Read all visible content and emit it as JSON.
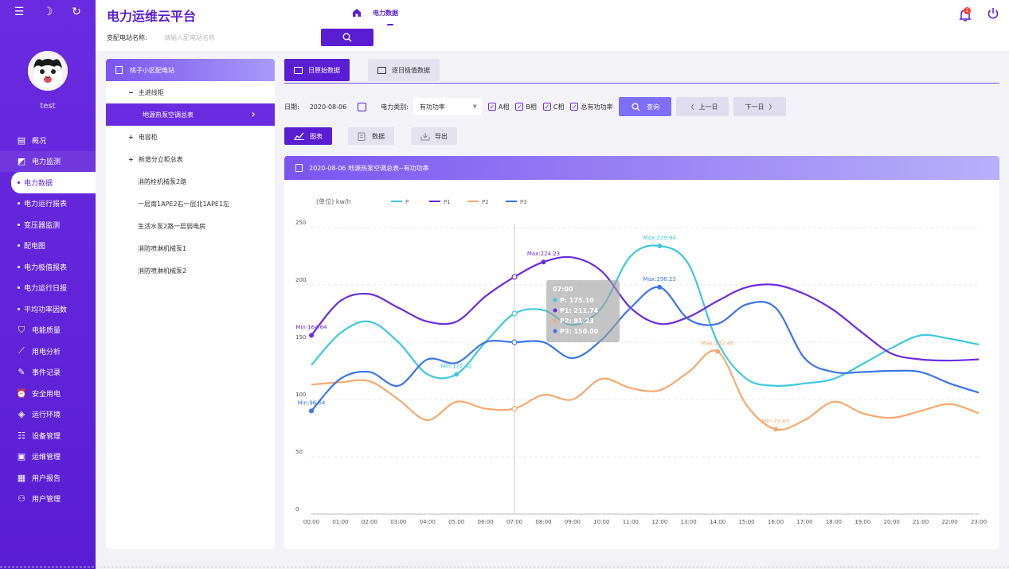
{
  "sidebar": {
    "top_icons": [
      "menu-icon",
      "moon-icon",
      "refresh-icon"
    ],
    "username": "test",
    "menu": [
      {
        "label": "概况",
        "icon": "dashboard-icon",
        "type": "main"
      },
      {
        "label": "电力监测",
        "icon": "monitor-icon",
        "type": "main"
      },
      {
        "label": "电力数据",
        "type": "sub",
        "active": true
      },
      {
        "label": "电力运行报表",
        "type": "sub"
      },
      {
        "label": "变压器监测",
        "type": "sub"
      },
      {
        "label": "配电图",
        "type": "sub"
      },
      {
        "label": "电力极值报表",
        "type": "sub"
      },
      {
        "label": "电力运行日报",
        "type": "sub"
      },
      {
        "label": "平均功率因数",
        "type": "sub"
      },
      {
        "label": "电能质量",
        "icon": "shield-icon",
        "type": "main"
      },
      {
        "label": "用电分析",
        "icon": "trend-icon",
        "type": "main"
      },
      {
        "label": "事件记录",
        "icon": "edit-doc-icon",
        "type": "main"
      },
      {
        "label": "安全用电",
        "icon": "alarm-icon",
        "type": "main"
      },
      {
        "label": "运行环境",
        "icon": "diamond-icon",
        "type": "main"
      },
      {
        "label": "设备管理",
        "icon": "list-icon",
        "type": "main"
      },
      {
        "label": "运维管理",
        "icon": "screen-icon",
        "type": "main"
      },
      {
        "label": "用户报告",
        "icon": "report-icon",
        "type": "main"
      },
      {
        "label": "用户管理",
        "icon": "users-icon",
        "type": "main"
      }
    ]
  },
  "header": {
    "title": "电力运维云平台",
    "nav_label": "电力数据",
    "search_label": "变配电站名称:",
    "search_placeholder": "请输入配电站名称",
    "notification_count": "2"
  },
  "tree": {
    "title": "桃子小区配电站",
    "items": [
      {
        "label": "主进线柜",
        "prefix": "−",
        "level": 1
      },
      {
        "label": "地源热泵空调总表",
        "level": 2,
        "active": true
      },
      {
        "label": "电容柜",
        "prefix": "+",
        "level": 1
      },
      {
        "label": "新增分立柜总表",
        "prefix": "+",
        "level": 1
      },
      {
        "label": "消防栓机械泵2路",
        "level": 2
      },
      {
        "label": "一层南1APE2右一层北1APE1左",
        "level": 2
      },
      {
        "label": "生活水泵2路一层弱电房",
        "level": 2
      },
      {
        "label": "消防喷淋机械泵1",
        "level": 2
      },
      {
        "label": "消防喷淋机械泵2",
        "level": 2
      }
    ]
  },
  "tabs": {
    "daily_raw": "日原始数据",
    "daily_extreme": "逐日极值数据"
  },
  "filter": {
    "date_label": "日期:",
    "date_value": "2020-08-06",
    "type_label": "电力类别:",
    "type_value": "有功功率",
    "phase_a": "A相",
    "phase_b": "B相",
    "phase_c": "C相",
    "total": "总有功功率",
    "query": "查询",
    "prev": "上一日",
    "next": "下一日"
  },
  "view_buttons": {
    "chart": "图表",
    "data": "数据",
    "export": "导出"
  },
  "chart_header": "2020-08-06  地源热泵空调总表--有功功率",
  "tooltip": {
    "time": "07:00",
    "lines": [
      "P:  175.10",
      "P1:  211.74",
      "P2:  91.23",
      "P3:  150.00"
    ]
  },
  "chart_data": {
    "type": "line",
    "unit_label": "(单位) kw/h",
    "x": [
      "00:00",
      "01:00",
      "02:00",
      "03:00",
      "04:00",
      "05:00",
      "06:00",
      "07:00",
      "08:00",
      "09:00",
      "10:00",
      "11:00",
      "12:00",
      "13:00",
      "14:00",
      "15:00",
      "16:00",
      "17:00",
      "18:00",
      "19:00",
      "20:00",
      "21:00",
      "22:00",
      "23:00"
    ],
    "ylim": [
      0,
      250
    ],
    "yticks": [
      0,
      50,
      100,
      150,
      200,
      250
    ],
    "grid": true,
    "legend_position": "top-left",
    "series": [
      {
        "name": "P",
        "color": "#3ec8dc",
        "values": [
          130,
          158,
          168,
          150,
          122,
          122,
          150,
          175,
          178,
          165,
          180,
          225,
          234,
          218,
          150,
          118,
          112,
          114,
          118,
          131,
          145,
          156,
          153,
          148
        ]
      },
      {
        "name": "P1",
        "color": "#6a2be0",
        "values": [
          156,
          186,
          192,
          180,
          168,
          168,
          190,
          207,
          220,
          224,
          212,
          180,
          166,
          172,
          186,
          198,
          200,
          192,
          178,
          158,
          140,
          135,
          134,
          135
        ]
      },
      {
        "name": "P2",
        "color": "#f5a96e",
        "values": [
          113,
          115,
          116,
          100,
          82,
          98,
          92,
          92,
          104,
          100,
          118,
          110,
          108,
          124,
          142,
          95,
          74,
          82,
          98,
          88,
          84,
          90,
          96,
          88
        ]
      },
      {
        "name": "P3",
        "color": "#3b74e8",
        "values": [
          90,
          118,
          124,
          112,
          135,
          132,
          150,
          150,
          150,
          136,
          152,
          180,
          198,
          170,
          166,
          183,
          180,
          136,
          124,
          124,
          125,
          124,
          114,
          106
        ]
      }
    ],
    "annotations": [
      {
        "series": "P",
        "label": "Min:122.42",
        "x": "05:00",
        "y": 122
      },
      {
        "series": "P",
        "label": "Max:239.84",
        "x": "12:00",
        "y": 234
      },
      {
        "series": "P1",
        "label": "Min:164.64",
        "x": "00:00",
        "y": 156
      },
      {
        "series": "P1",
        "label": "Max:224.23",
        "x": "08:00",
        "y": 220
      },
      {
        "series": "P2",
        "label": "Min:75.65",
        "x": "16:00",
        "y": 74
      },
      {
        "series": "P2",
        "label": "Max:132.45",
        "x": "14:00",
        "y": 142
      },
      {
        "series": "P3",
        "label": "Min:96.64",
        "x": "00:00",
        "y": 90
      },
      {
        "series": "P3",
        "label": "Max:198.23",
        "x": "12:00",
        "y": 198
      }
    ]
  }
}
